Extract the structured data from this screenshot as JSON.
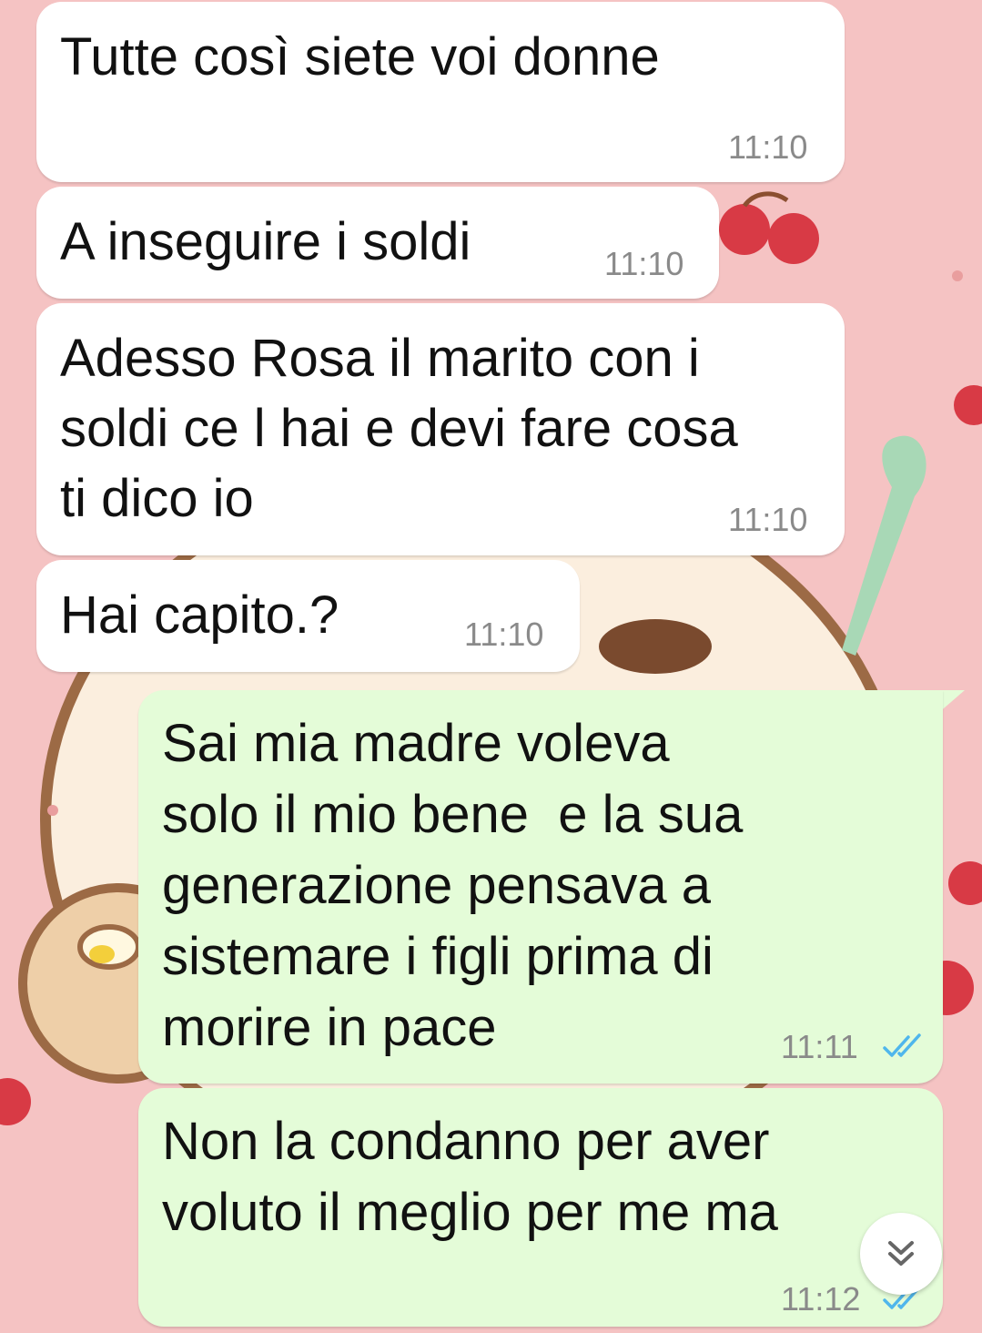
{
  "chat": {
    "messages": [
      {
        "direction": "incoming",
        "lines": [
          "Tutte così siete voi donne"
        ],
        "time": "11:10"
      },
      {
        "direction": "incoming",
        "lines": [
          "A inseguire i soldi"
        ],
        "time": "11:10"
      },
      {
        "direction": "incoming",
        "lines": [
          "Adesso Rosa il marito con i",
          "soldi ce l hai e devi fare cosa",
          "ti dico io"
        ],
        "time": "11:10"
      },
      {
        "direction": "incoming",
        "lines": [
          "Hai capito.?"
        ],
        "time": "11:10"
      },
      {
        "direction": "outgoing",
        "lines": [
          "Sai mia madre voleva",
          "solo il mio bene  e la sua",
          "generazione pensava a",
          "sistemare i figli prima di",
          "morire in pace"
        ],
        "time": "11:11",
        "status": "read"
      },
      {
        "direction": "outgoing",
        "lines": [
          "Non la condanno per aver",
          "voluto il meglio per me ma"
        ],
        "time": "11:12",
        "status": "read"
      }
    ]
  },
  "icons": {
    "read_receipt": "double-check-icon",
    "scroll_down": "double-chevron-down-icon"
  },
  "colors": {
    "wallpaper": "#f5c3c3",
    "incoming_bubble": "#ffffff",
    "outgoing_bubble": "#e4fcd8",
    "read_ticks": "#4fb6ec",
    "timestamp": "#8a8a8a"
  }
}
